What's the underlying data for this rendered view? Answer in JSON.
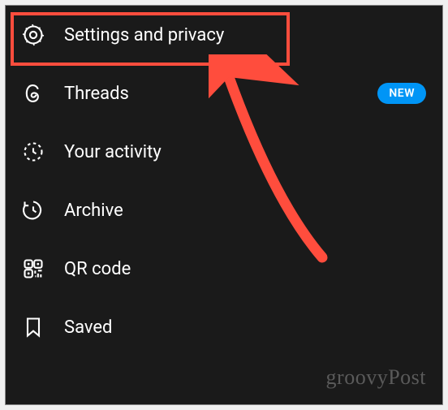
{
  "menu": {
    "items": [
      {
        "label": "Settings and privacy",
        "icon": "gear"
      },
      {
        "label": "Threads",
        "icon": "threads",
        "badge": "NEW"
      },
      {
        "label": "Your activity",
        "icon": "activity-clock"
      },
      {
        "label": "Archive",
        "icon": "archive-clock"
      },
      {
        "label": "QR code",
        "icon": "qr-code"
      },
      {
        "label": "Saved",
        "icon": "bookmark"
      }
    ]
  },
  "watermark": "groovyPost",
  "annotation": {
    "type": "highlight-arrow",
    "target": "Settings and privacy"
  }
}
